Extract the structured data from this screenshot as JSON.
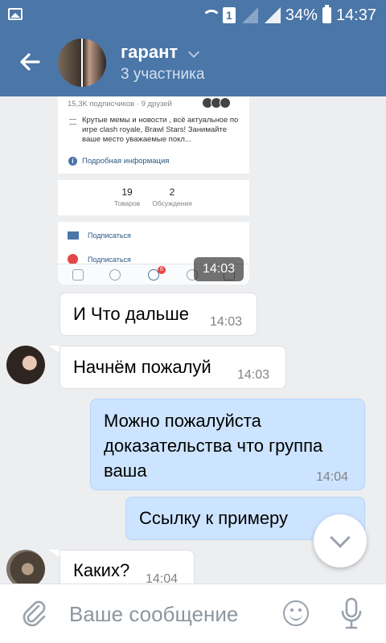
{
  "status_bar": {
    "sim_label": "1",
    "battery": "34%",
    "time": "14:37"
  },
  "header": {
    "title": "гарант",
    "subtitle": "3 участника"
  },
  "screenshot_message": {
    "subscribers": "15,3K подписчиков · 9 друзей",
    "description": "Крутые мемы и новости , всё актуальное по игре clash royale, Brawl Stars! Занимайте ваше место уважаемые покл...",
    "info_link": "Подробная информация",
    "stats": [
      {
        "number": "19",
        "label": "Товаров"
      },
      {
        "number": "2",
        "label": "Обсуждения"
      }
    ],
    "subscribe_1": "Подписаться",
    "subscribe_2": "Подписаться",
    "tab_badge": "6",
    "time": "14:03"
  },
  "messages": [
    {
      "direction": "out",
      "text": "И Что дальше",
      "time": "14:03"
    },
    {
      "direction": "in",
      "text": "Начнём пожалуй",
      "time": "14:03"
    },
    {
      "direction": "out",
      "text": "Можно пожалуйста доказательства что группа ваша",
      "lines": [
        "Можно пожалуйста",
        "доказательства что группа",
        "ваша"
      ],
      "time": "14:04"
    },
    {
      "direction": "out",
      "text": "Ссылку к примеру",
      "time": ""
    },
    {
      "direction": "in",
      "text": "Каких?",
      "time": "14:04"
    }
  ],
  "composer": {
    "placeholder": "Ваше сообщение"
  },
  "colors": {
    "header": "#4a76a8",
    "outgoing_bubble": "#cce4ff",
    "incoming_bubble": "#ffffff",
    "background": "#edeef0"
  }
}
